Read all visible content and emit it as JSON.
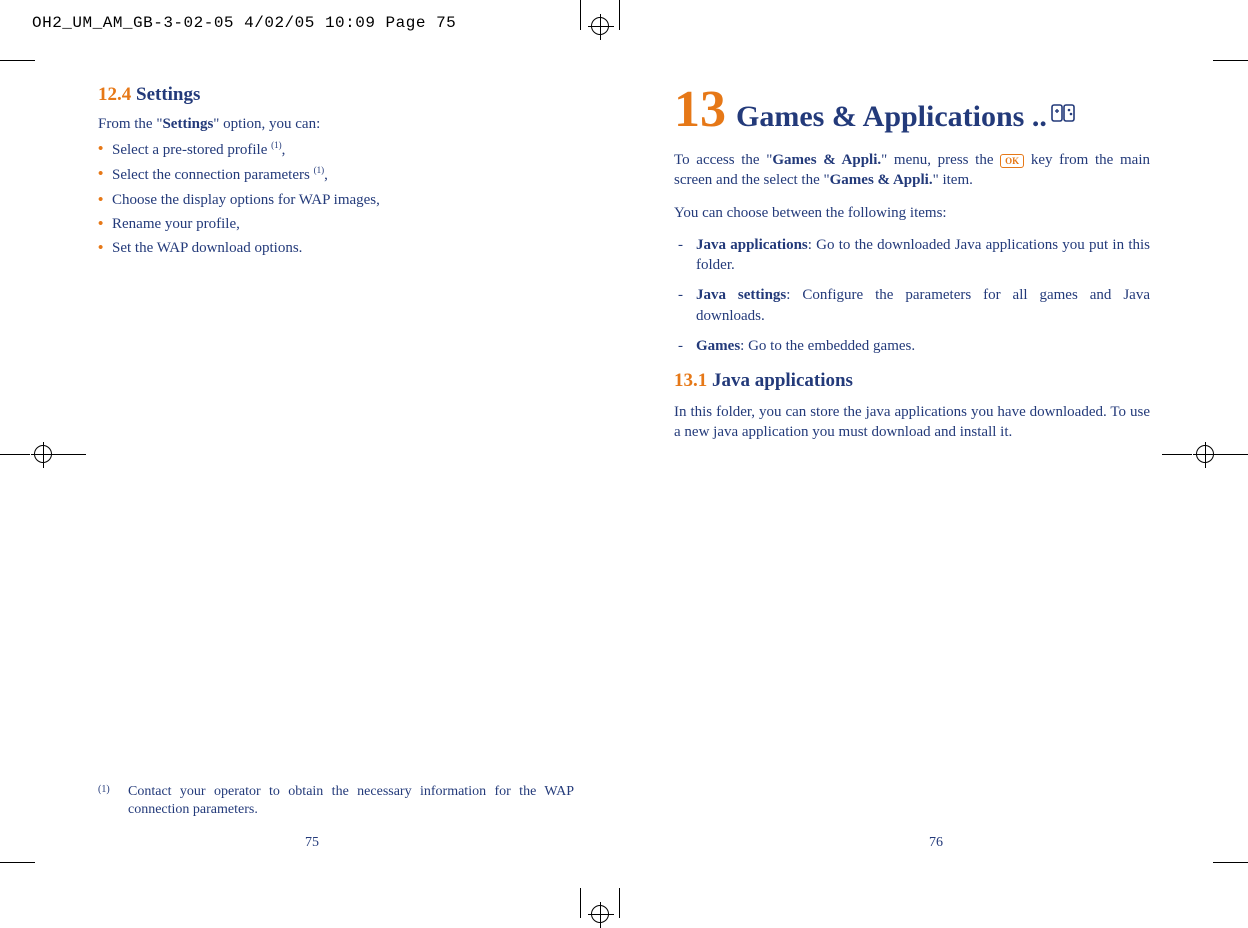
{
  "slug": "OH2_UM_AM_GB-3-02-05   4/02/05  10:09  Page 75",
  "left": {
    "section_num": "12.4",
    "section_title": "Settings",
    "intro_pre": "From the \"",
    "intro_bold": "Settings",
    "intro_post": "\" option, you can:",
    "bullets": [
      {
        "text": "Select a pre-stored profile ",
        "sup": "(1)",
        "tail": ","
      },
      {
        "text": "Select the connection parameters ",
        "sup": "(1)",
        "tail": ","
      },
      {
        "text": "Choose the display options for WAP images,",
        "sup": "",
        "tail": ""
      },
      {
        "text": "Rename your profile,",
        "sup": "",
        "tail": ""
      },
      {
        "text": "Set the WAP download options.",
        "sup": "",
        "tail": ""
      }
    ],
    "footnote_mark": "(1)",
    "footnote_text": "Contact your operator to obtain the necessary information for the WAP connection parameters.",
    "page_number": "75"
  },
  "right": {
    "chapter_num": "13",
    "chapter_title": "Games & Applications ..",
    "p1_a": "To access the \"",
    "p1_b": "Games & Appli.",
    "p1_c": "\" menu, press the ",
    "ok_label": "OK",
    "p1_d": " key from the main screen and the select the \"",
    "p1_e": "Games & Appli.",
    "p1_f": "\" item.",
    "p2": "You can choose between the following items:",
    "items": [
      {
        "bold": "Java applications",
        "rest": ": Go to the downloaded Java applications you put in this folder."
      },
      {
        "bold": "Java settings",
        "rest": ": Configure the parameters for all games and Java downloads.",
        "wide": true
      },
      {
        "bold": "Games",
        "rest": ": Go to the embedded games."
      }
    ],
    "sub_num": "13.1",
    "sub_title": "Java applications",
    "p3": "In this folder, you can store the java applications you have downloaded. To use a new java application you must download and install it.",
    "page_number": "76"
  }
}
